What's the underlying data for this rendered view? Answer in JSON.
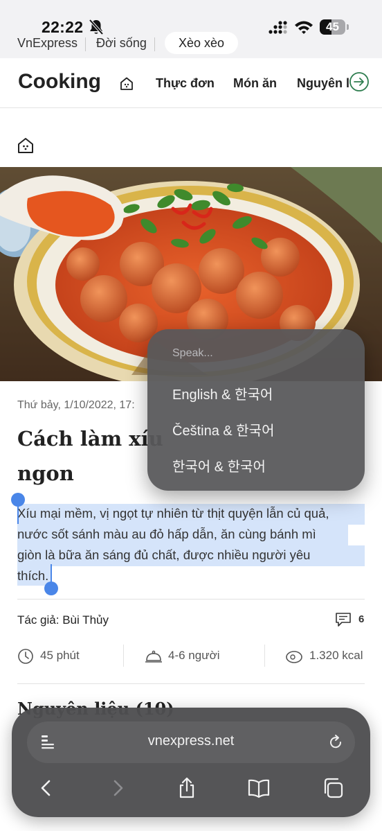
{
  "status_bar": {
    "time": "22:22",
    "battery_level": "45",
    "icons": [
      "bell-slash-icon",
      "cellular-signal-icon",
      "wifi-icon",
      "battery-icon"
    ]
  },
  "crumbs": {
    "site": "VnExpress",
    "section": "Đời sống",
    "subsection": "Xèo xèo"
  },
  "cooking_nav": {
    "title": "Cooking",
    "items": [
      "Thực đơn",
      "Món ăn",
      "Nguyên li"
    ],
    "icons": [
      "home-icon",
      "arrow-right-circle-icon"
    ],
    "accent_color": "#2e7d4f"
  },
  "article": {
    "date": "Thứ bảy, 1/10/2022, 17:",
    "title_lines": [
      "Cách làm xíu",
      "ngon"
    ],
    "lede_lines": [
      "Xíu mại mềm, vị ngọt tự nhiên từ thịt quyện lẫn củ quả,",
      "nước sốt sánh màu au đỏ hấp dẫn, ăn cùng bánh mì",
      "giòn là bữa ăn sáng đủ chất, được nhiều người yêu",
      "thích."
    ],
    "author": "Tác giả: Bùi Thủy",
    "comment_count": "6",
    "meta": {
      "time": "45 phút",
      "servings": "4-6 người",
      "calories": "1.320 kcal"
    },
    "next_section_peek": "Nguyên liệu (10)"
  },
  "speak_menu": {
    "header": "Speak...",
    "options": [
      "English & 한국어",
      "Čeština & 한국어",
      "한국어 & 한국어"
    ]
  },
  "toolbar": {
    "url": "vnexpress.net",
    "icons": [
      "reader-icon",
      "reload-icon",
      "back-icon",
      "forward-icon",
      "share-icon",
      "bookmarks-icon",
      "tabs-icon"
    ]
  },
  "colors": {
    "selection": "#d5e4fa",
    "selection_handle": "#4a86e8"
  }
}
